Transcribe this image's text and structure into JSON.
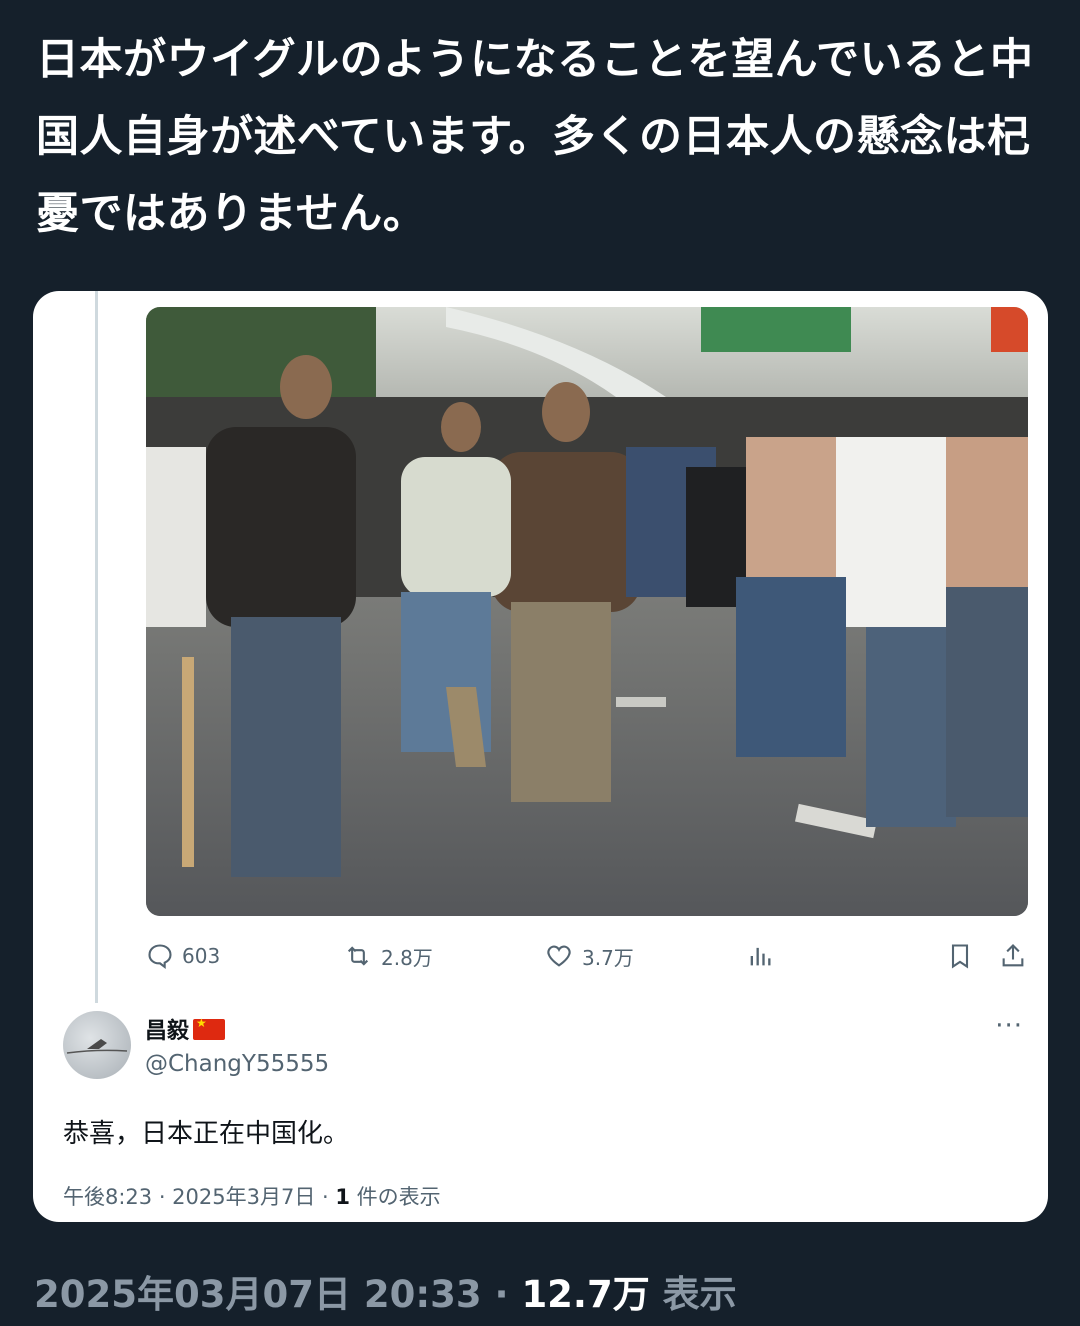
{
  "post": {
    "text": "日本がウイグルのようになることを望んでいると中国人自身が述べています。多くの日本人の懸念は杞憂ではありません。"
  },
  "quoted_post": {
    "photo_alt_icon": "protest-photo",
    "actions": {
      "replies": "603",
      "reposts": "2.8万",
      "likes": "3.7万"
    }
  },
  "reply": {
    "display_name": "昌毅",
    "flag_icon": "china-flag-icon",
    "handle": "@ChangY55555",
    "text": "恭喜，日本正在中国化。",
    "time": "午後8:23 · 2025年3月7日 · ",
    "views_count": "1",
    "views_label": " 件の表示"
  },
  "footer": {
    "timestamp": "2025年03月07日 20:33 · ",
    "views_count": "12.7万",
    "views_label": " 表示"
  },
  "colors": {
    "background": "#15202b",
    "card": "#ffffff",
    "muted": "#536471"
  }
}
